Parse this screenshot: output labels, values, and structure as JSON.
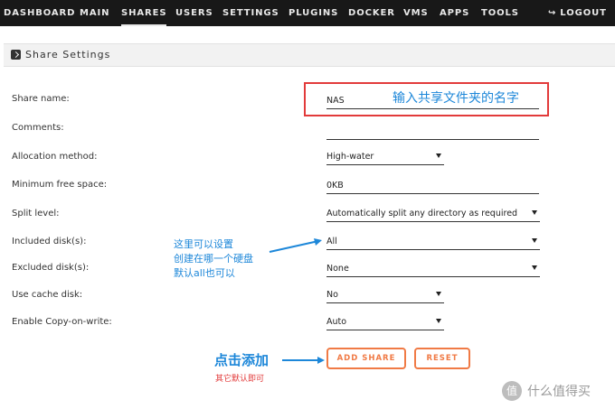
{
  "nav": {
    "items": [
      "DASHBOARD",
      "MAIN",
      "SHARES",
      "USERS",
      "SETTINGS",
      "PLUGINS",
      "DOCKER",
      "VMS",
      "APPS",
      "TOOLS"
    ],
    "active": "SHARES",
    "logout_label": "LOGOUT",
    "logout_icon": "logout-icon"
  },
  "section": {
    "title": "Share Settings",
    "icon": "share-icon"
  },
  "form": {
    "share_name": {
      "label": "Share name:",
      "value": "NAS"
    },
    "comments": {
      "label": "Comments:",
      "value": ""
    },
    "allocation": {
      "label": "Allocation method:",
      "value": "High-water"
    },
    "min_free": {
      "label": "Minimum free space:",
      "value": "0KB"
    },
    "split": {
      "label": "Split level:",
      "value": "Automatically split any directory as required"
    },
    "included": {
      "label": "Included disk(s):",
      "value": "All"
    },
    "excluded": {
      "label": "Excluded disk(s):",
      "value": "None"
    },
    "cache": {
      "label": "Use cache disk:",
      "value": "No"
    },
    "cow": {
      "label": "Enable Copy-on-write:",
      "value": "Auto"
    }
  },
  "buttons": {
    "add": "ADD SHARE",
    "reset": "RESET"
  },
  "annotations": {
    "name_hint": "输入共享文件夹的名字",
    "disk_hint_1": "这里可以设置",
    "disk_hint_2": "创建在哪一个硬盘",
    "disk_hint_3": "默认all也可以",
    "click_add": "点击添加",
    "others_default": "其它默认即可"
  },
  "watermark": {
    "logo": "值",
    "text": "什么值得买"
  },
  "colors": {
    "nav_bg": "#181818",
    "accent": "#f07a45",
    "annotation_blue": "#1d87d9",
    "annotation_red": "#e23a3a"
  }
}
